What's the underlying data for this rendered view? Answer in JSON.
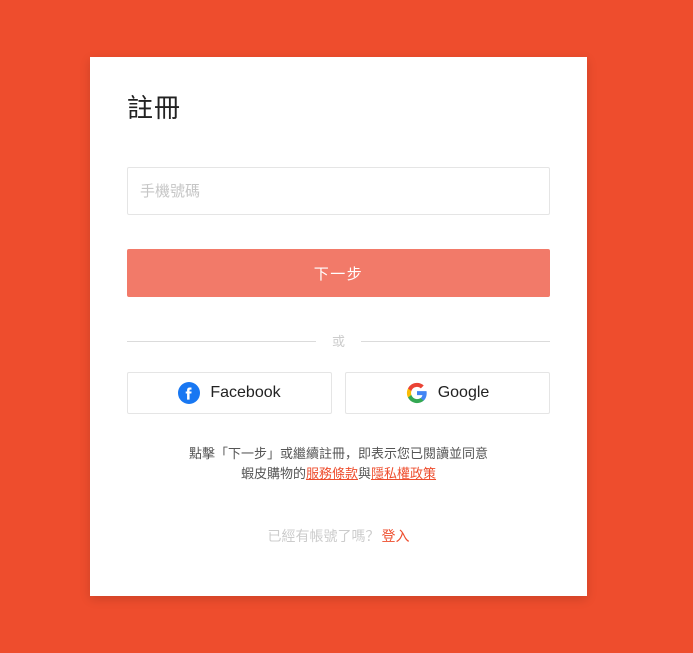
{
  "page": {
    "background_color": "#ee4d2d",
    "brand_color": "#ee4d2d"
  },
  "card": {
    "title": "註冊",
    "phone_field": {
      "placeholder": "手機號碼",
      "value": ""
    },
    "primary_button": {
      "label": "下一步",
      "color": "#f27a69",
      "state": "disabled"
    },
    "divider": {
      "text": "或"
    },
    "social": [
      {
        "icon": "facebook-icon",
        "label": "Facebook",
        "color": "#1877f2"
      },
      {
        "icon": "google-icon",
        "label": "Google",
        "color": "#4285f4"
      }
    ],
    "terms": {
      "line1_prefix": "點擊「下一步」或繼續註冊，即表示您已閱讀並同意",
      "line2_prefix": "蝦皮購物的",
      "link_terms": "服務條款",
      "between": "與",
      "link_privacy": "隱私權政策",
      "link_color": "#ee4d2d"
    },
    "login": {
      "question": "已經有帳號了嗎？",
      "link": "登入",
      "link_color": "#ee4d2d"
    }
  }
}
